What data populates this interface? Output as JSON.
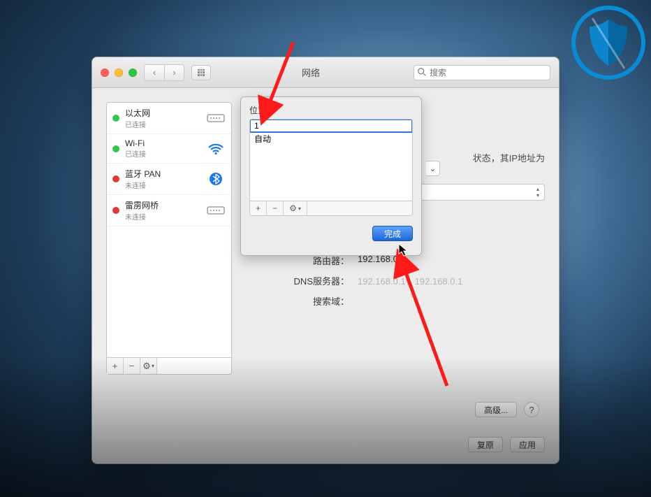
{
  "window": {
    "title": "网络",
    "search_placeholder": "搜索",
    "location_label": "位",
    "location_popup_hint": "⌄"
  },
  "services": [
    {
      "name": "以太网",
      "sub": "已连接",
      "status_color": "#33c64c",
      "icon": "ethernet"
    },
    {
      "name": "Wi-Fi",
      "sub": "已连接",
      "status_color": "#33c64c",
      "icon": "wifi"
    },
    {
      "name": "蓝牙 PAN",
      "sub": "未连接",
      "status_color": "#e23838",
      "icon": "bluetooth"
    },
    {
      "name": "雷雳网桥",
      "sub": "未连接",
      "status_color": "#e23838",
      "icon": "thunderbolt"
    }
  ],
  "sidebar_footer": {
    "add": "+",
    "remove": "−",
    "gear": "⚙︎"
  },
  "detail": {
    "status_suffix": "状态，其IP地址为",
    "router_label": "路由器：",
    "router_value": "192.168.0.1",
    "dns_label": "DNS服务器：",
    "dns_value": "192.168.0.1，192.168.0.1",
    "search_label": "搜索域：",
    "advanced": "高级...",
    "help": "?"
  },
  "actions": {
    "revert": "复原",
    "apply": "应用"
  },
  "dialog": {
    "title": "位置",
    "editing_value": "1",
    "item2": "自动",
    "add": "+",
    "remove": "−",
    "gear": "⚙︎",
    "done": "完成"
  }
}
